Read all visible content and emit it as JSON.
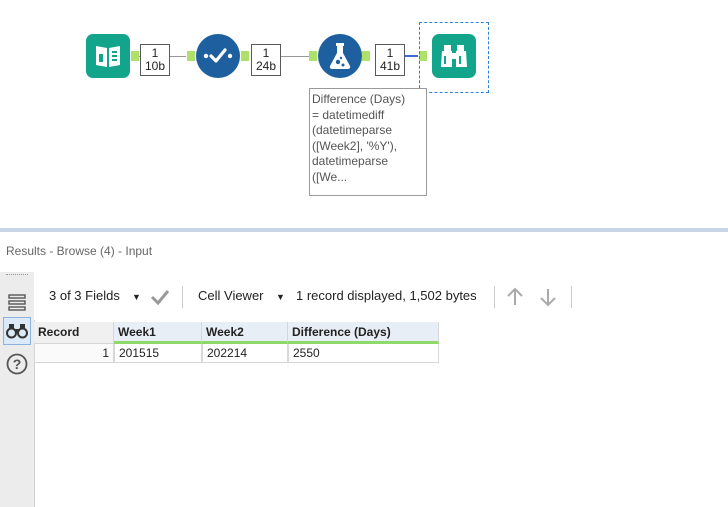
{
  "workflow": {
    "badges": [
      {
        "count": "1",
        "size": "10b"
      },
      {
        "count": "1",
        "size": "24b"
      },
      {
        "count": "1",
        "size": "41b"
      }
    ],
    "tooltip": "Difference (Days)\n= datetimediff\n(datetimeparse\n([Week2], '%Y'),\ndatetimeparse\n([We...",
    "tools": [
      "input-data-tool",
      "select-tool",
      "formula-tool",
      "browse-tool"
    ]
  },
  "results": {
    "title": "Results - Browse (4) - Input",
    "fields_label": "3 of 3 Fields",
    "viewer_label": "Cell Viewer",
    "status": "1 record displayed, 1,502 bytes",
    "columns": [
      "Record",
      "Week1",
      "Week2",
      "Difference (Days)"
    ],
    "rows": [
      {
        "record": "1",
        "week1": "201515",
        "week2": "202214",
        "difference": "2550"
      }
    ]
  },
  "colors": {
    "teal_tool": "#13a58b",
    "blue_tool": "#1e5fa0",
    "anchor_green": "#aee16b",
    "field_underline": "#8fd86a"
  }
}
